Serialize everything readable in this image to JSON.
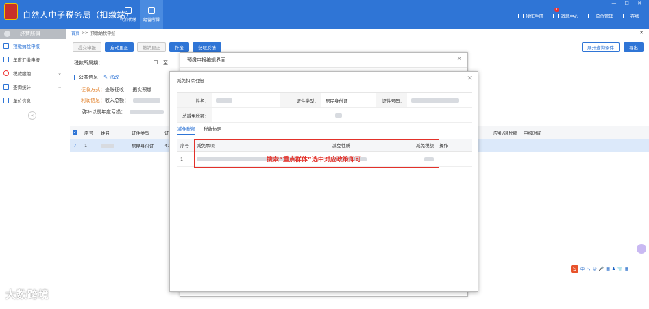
{
  "app": {
    "title": "自然人电子税务局（扣缴端）",
    "window_controls": "— ☐ ✕"
  },
  "topnav": [
    {
      "label": "代扣代缴"
    },
    {
      "label": "经营所得"
    }
  ],
  "toplinks": [
    {
      "label": "操作手册"
    },
    {
      "label": "消息中心",
      "badge": "1"
    },
    {
      "label": "单位管理"
    },
    {
      "label": "在线"
    }
  ],
  "sidebar": {
    "header": "经营所得",
    "items": [
      {
        "label": "预缴纳税申报"
      },
      {
        "label": "年度汇缴申报"
      },
      {
        "label": "税款缴纳"
      },
      {
        "label": "查询统计"
      },
      {
        "label": "单位信息"
      }
    ],
    "collapse": "«"
  },
  "breadcrumb": {
    "home": "首页",
    "sep": ">>",
    "current": "预缴纳税申报",
    "close": "✕"
  },
  "toolbar": {
    "buttons": [
      {
        "label": "提交申报"
      },
      {
        "label": "启动更正"
      },
      {
        "label": "撤销更正"
      },
      {
        "label": "作废"
      },
      {
        "label": "获取反馈"
      }
    ],
    "right": [
      {
        "label": "展开查询条件"
      },
      {
        "label": "导出"
      }
    ]
  },
  "filter": {
    "label": "税款所属期：",
    "to": "至"
  },
  "info": {
    "title": "公共信息",
    "edit": "修改",
    "levy_label": "征收方式：",
    "levy_value": "查账征收",
    "levy_extra": "据实预缴",
    "profit_label": "利润信息：",
    "income_label": "收入总额：",
    "loss_label": "弥补以前年度亏损："
  },
  "table": {
    "headers": [
      "序号",
      "姓名",
      "证件类型",
      "证",
      "应补/退税额",
      "申报时间"
    ],
    "row": {
      "no": "1",
      "id_type": "居民身份证",
      "id_prefix": "41"
    }
  },
  "dialog_back": {
    "title": "预缴申报编辑界面",
    "close": "✕"
  },
  "dialog": {
    "title": "减免扣除明细",
    "close": "✕",
    "name_label": "姓名：",
    "id_type_label": "证件类型：",
    "id_type_value": "居民身份证",
    "id_no_label": "证件号码：",
    "total_label": "总减免税额：",
    "tabs": [
      "减免税额",
      "税收协定"
    ],
    "table_headers": [
      "序号",
      "减免事项",
      "减免性质",
      "减免税额",
      "操作"
    ],
    "row_no": "1"
  },
  "annotation": "搜索“重点群体”选中对应政策即可",
  "watermark": "大数跨境",
  "ime": {
    "items": [
      "中",
      "◦,",
      "☺",
      "🎤",
      "▦",
      "♟",
      "👕",
      "▦"
    ]
  }
}
